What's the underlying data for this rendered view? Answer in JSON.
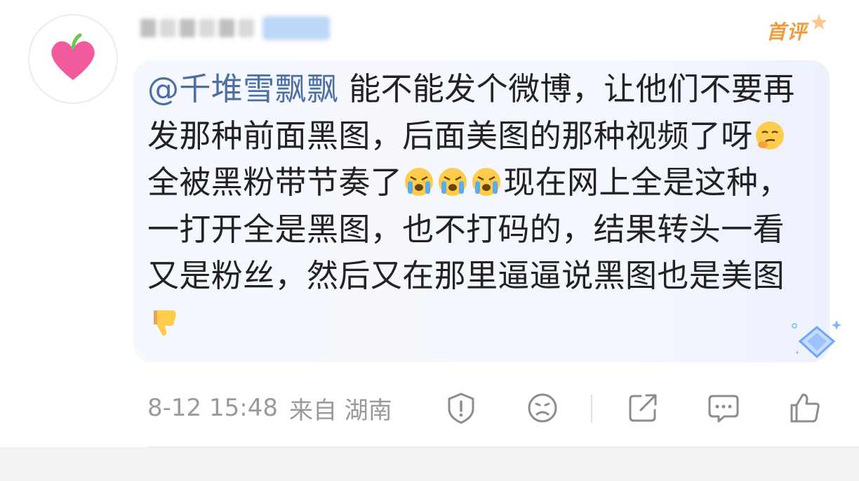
{
  "comment": {
    "mention": "@千堆雪飘飘",
    "text_segments": [
      " 能不能发个微博，让他们不要再发那种前面黑图，后面美图的那种视频了呀",
      "全被黑粉带节奏了",
      "现在网上全是这种，一打开全是黑图，也不打码的，结果转头一看又是粉丝，然后又在那里逼逼说黑图也是美图"
    ],
    "emojis": [
      "thinking-face-emoji",
      "crying-face-emoji",
      "crying-face-emoji",
      "crying-face-emoji",
      "thumbs-down-emoji"
    ]
  },
  "badge": {
    "first_comment": "首评"
  },
  "meta": {
    "date": "8-12 15:48",
    "location": "来自 湖南"
  },
  "actions": [
    "report-icon",
    "dislike-icon",
    "share-icon",
    "comment-icon",
    "like-icon"
  ],
  "colors": {
    "mention": "#4b6ea3",
    "badge": "#f39a3d",
    "meta_text": "#9a9a9a",
    "bubble_bg": "#f5f7fe"
  }
}
